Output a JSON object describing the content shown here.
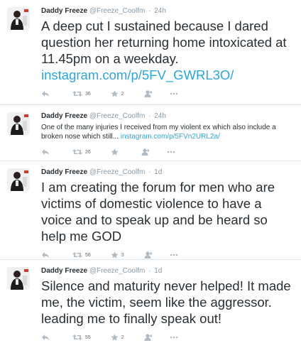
{
  "tweets": [
    {
      "name": "Daddy Freeze",
      "handle": "@Freeze_Coolfm",
      "sep": "·",
      "time": "24h",
      "text": "A deep cut I sustained because I dared question her returning home intoxicated at 11.45pm on a weekday.",
      "link": "instagram.com/p/5FV_GWRL3O/",
      "retweets": "36",
      "favorites": "2"
    },
    {
      "name": "Daddy Freeze",
      "handle": "@Freeze_Coolfm",
      "sep": "·",
      "time": "24h",
      "text": "One of the many injuries I received from my violent ex which also include a broken nose which still...",
      "link": "instagram.com/p/5FVn2URL2a/",
      "retweets": "26",
      "favorites": ""
    },
    {
      "name": "Daddy Freeze",
      "handle": "@Freeze_Coolfm",
      "sep": "·",
      "time": "1d",
      "text": "I am creating the forum for men who are victims of domestic violence to have a voice and to speak up and be heard so help me GOD",
      "link": "",
      "retweets": "58",
      "favorites": "3"
    },
    {
      "name": "Daddy Freeze",
      "handle": "@Freeze_Coolfm",
      "sep": "·",
      "time": "1d",
      "text": "Silence and maturity never helped! It made me, the victim, seem like the aggressor. leading me to finally speak out!",
      "link": "",
      "retweets": "55",
      "favorites": "2"
    }
  ],
  "icons": {
    "reply": "reply-icon",
    "retweet": "retweet-icon",
    "favorite": "star-icon",
    "follow": "follow-icon",
    "more": "more-icon"
  },
  "colors": {
    "link": "#2ba6de",
    "muted": "#8899a6",
    "text": "#292f33",
    "divider": "#e1e8ed"
  }
}
